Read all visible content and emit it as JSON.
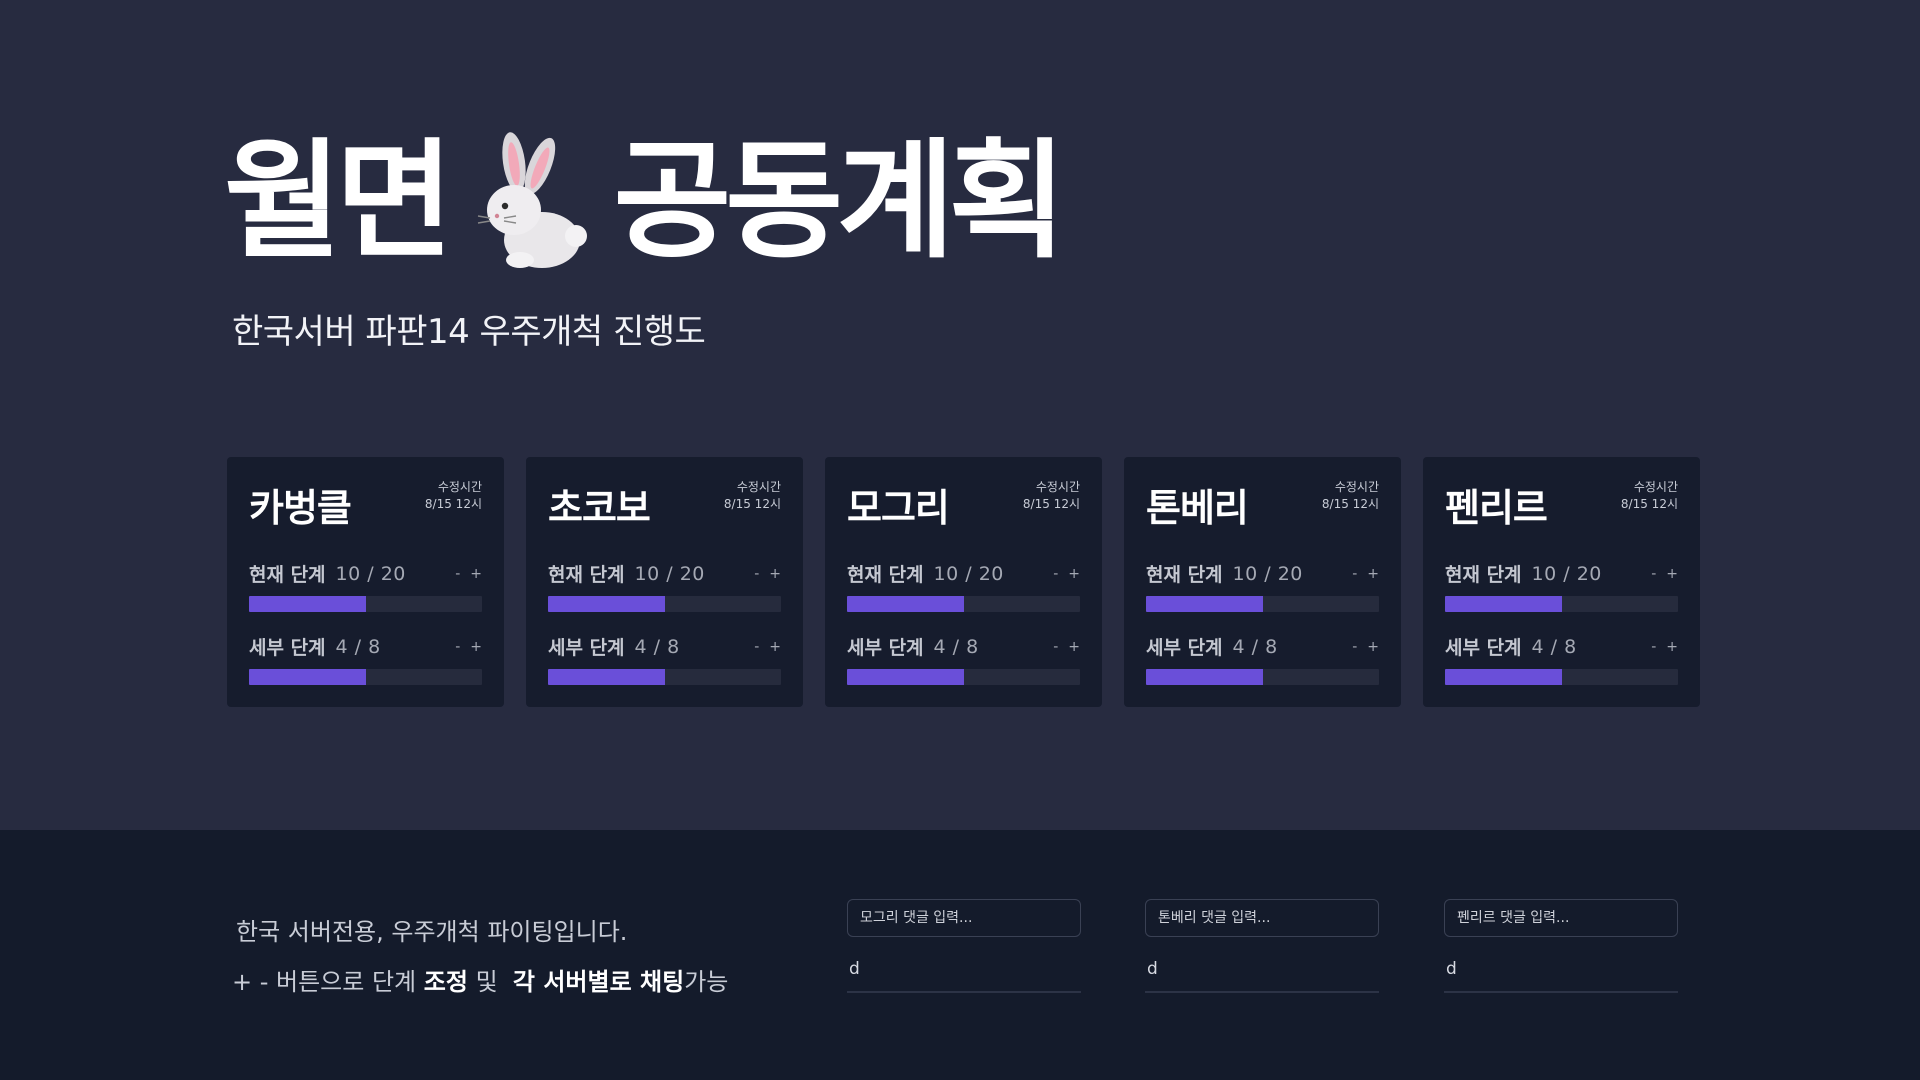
{
  "title": {
    "left": "월면",
    "right": "공동계획",
    "icon": "rabbit-icon"
  },
  "subtitle": "한국서버 파판14 우주개척 진행도",
  "edit_label": "수정시간",
  "edit_time": "8/15 12시",
  "stage_label": "현재 단계",
  "substage_label": "세부 단계",
  "minus": "-",
  "plus": "+",
  "cards": [
    {
      "name": "카벙클",
      "stage": "10 / 20",
      "stage_progress": 0.5,
      "substage": "4 / 8",
      "substage_progress": 0.5
    },
    {
      "name": "초코보",
      "stage": "10 / 20",
      "stage_progress": 0.5,
      "substage": "4 / 8",
      "substage_progress": 0.5
    },
    {
      "name": "모그리",
      "stage": "10 / 20",
      "stage_progress": 0.5,
      "substage": "4 / 8",
      "substage_progress": 0.5
    },
    {
      "name": "톤베리",
      "stage": "10 / 20",
      "stage_progress": 0.5,
      "substage": "4 / 8",
      "substage_progress": 0.5
    },
    {
      "name": "펜리르",
      "stage": "10 / 20",
      "stage_progress": 0.5,
      "substage": "4 / 8",
      "substage_progress": 0.5
    }
  ],
  "bottom": {
    "info_line1": "한국 서버전용, 우주개척 파이팅입니다.",
    "info_line2_a": "+ - 버튼으로 단계 ",
    "info_line2_b": "조정",
    "info_line2_c": " 및  ",
    "info_line2_d": "각 서버별로 채팅",
    "info_line2_e": "가능",
    "comments": [
      {
        "placeholder": "모그리 댓글 입력...",
        "text": "d"
      },
      {
        "placeholder": "톤베리 댓글 입력...",
        "text": "d"
      },
      {
        "placeholder": "펜리르 댓글 입력...",
        "text": "d"
      }
    ]
  },
  "colors": {
    "background": "#272b40",
    "card": "#161c2d",
    "bar_track": "#262b3d",
    "bar_fill": "#6a4fd9",
    "bottom_panel": "#141b2b"
  }
}
